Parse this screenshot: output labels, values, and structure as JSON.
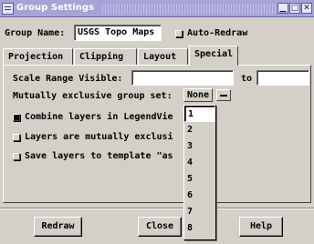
{
  "window": {
    "title": "Group Settings"
  },
  "group": {
    "name_label": "Group Name:",
    "name_value": "USGS Topo Maps",
    "auto_redraw_label": "Auto-Redraw"
  },
  "tabs": [
    {
      "label": "Projection"
    },
    {
      "label": "Clipping"
    },
    {
      "label": "Layout"
    },
    {
      "label": "Special"
    }
  ],
  "special": {
    "scale_range_label": "Scale Range Visible:",
    "scale_to_label": "to",
    "mutex_label": "Mutually exclusive group set:",
    "mutex_value": "None",
    "combine_label": "Combine layers in LegendVie",
    "layers_mutex_label": "Layers are mutually exclusi",
    "save_template_label": "Save layers to template \"as"
  },
  "dropdown": {
    "options": [
      "1",
      "2",
      "3",
      "4",
      "5",
      "6",
      "7",
      "8"
    ]
  },
  "buttons": {
    "redraw": "Redraw",
    "close": "Close",
    "help": "Help"
  }
}
